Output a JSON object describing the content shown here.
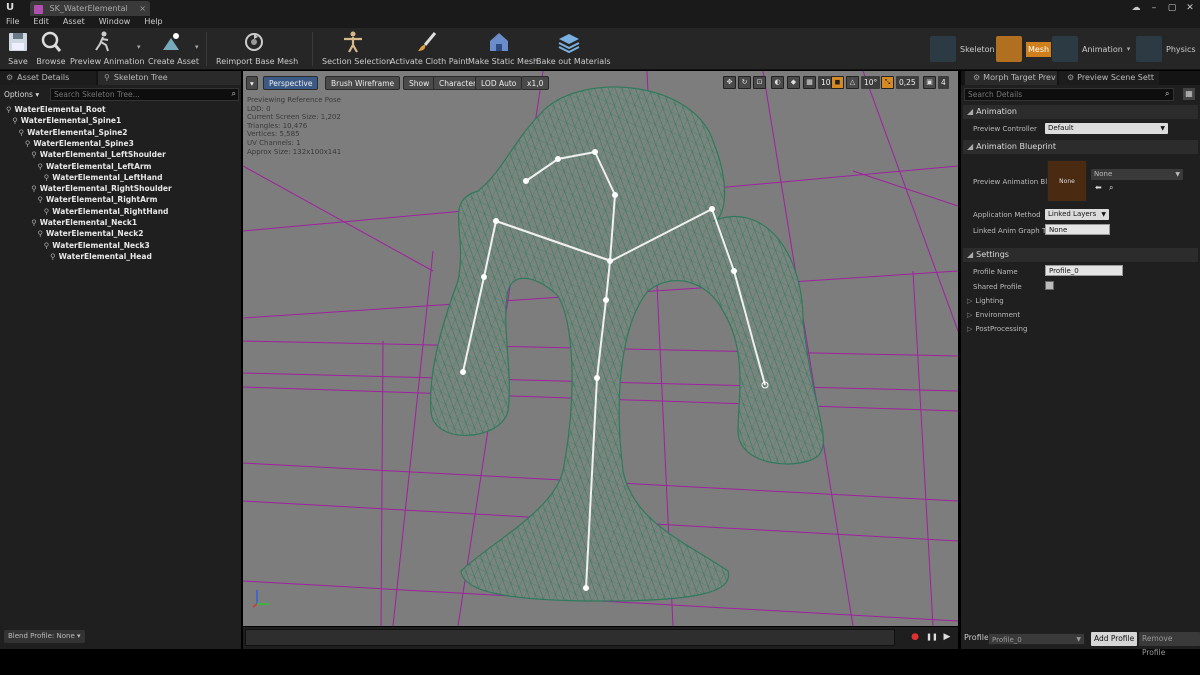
{
  "window": {
    "app_logo": "U",
    "tab_title": "SK_WaterElemental",
    "tab_close": "×",
    "controls": [
      "☁",
      "–",
      "▢",
      "✕"
    ]
  },
  "menu": [
    "File",
    "Edit",
    "Asset",
    "Window",
    "Help"
  ],
  "toolbar": {
    "save": "Save",
    "browse": "Browse",
    "preview_animation": "Preview Animation",
    "create_asset": "Create Asset",
    "reimport_base_mesh": "Reimport Base Mesh",
    "section_selection": "Section Selection",
    "activate_cloth_paint": "Activate Cloth Paint",
    "make_static_mesh": "Make Static Mesh",
    "bake_out_materials": "Bake out Materials",
    "modes": [
      "Skeleton",
      "Mesh",
      "Animation",
      "Physics"
    ],
    "active_mode": "Mesh",
    "accent_color": "#d07f1f"
  },
  "left_panel": {
    "tabs": [
      "Asset Details",
      "Skeleton Tree"
    ],
    "options_label": "Options ▾",
    "search_placeholder": "Search Skeleton Tree...",
    "bones": [
      {
        "name": "WaterElemental_Root",
        "depth": 0
      },
      {
        "name": "WaterElemental_Spine1",
        "depth": 1
      },
      {
        "name": "WaterElemental_Spine2",
        "depth": 2
      },
      {
        "name": "WaterElemental_Spine3",
        "depth": 3
      },
      {
        "name": "WaterElemental_LeftShoulder",
        "depth": 4
      },
      {
        "name": "WaterElemental_LeftArm",
        "depth": 5
      },
      {
        "name": "WaterElemental_LeftHand",
        "depth": 6
      },
      {
        "name": "WaterElemental_RightShoulder",
        "depth": 4
      },
      {
        "name": "WaterElemental_RightArm",
        "depth": 5
      },
      {
        "name": "WaterElemental_RightHand",
        "depth": 6
      },
      {
        "name": "WaterElemental_Neck1",
        "depth": 4
      },
      {
        "name": "WaterElemental_Neck2",
        "depth": 5
      },
      {
        "name": "WaterElemental_Neck3",
        "depth": 6
      },
      {
        "name": "WaterElemental_Head",
        "depth": 7
      }
    ],
    "blend_profile": "Blend Profile: None ▾"
  },
  "viewport": {
    "perspective": "Perspective",
    "brush_wireframe": "Brush Wireframe",
    "show": "Show",
    "character": "Character",
    "lod": "LOD Auto",
    "playback_speed": "x1,0",
    "grid_snap": "10",
    "rotation_snap": "10°",
    "scale_snap": "0,25",
    "camera_speed": "4",
    "stats": [
      "Previewing Reference Pose",
      "LOD: 0",
      "Current Screen Size: 1,202",
      "Triangles: 10,476",
      "Vertices: 5,585",
      "UV Channels: 1",
      "Approx Size: 132x100x141"
    ],
    "wire_color": "#2f7a5c",
    "grid_color": "#a020a0"
  },
  "timeline": {
    "record": "●",
    "pause": "❚❚",
    "forward": "▶"
  },
  "right_panel": {
    "tabs": [
      "Morph Target Prev",
      "Preview Scene Sett"
    ],
    "search_placeholder": "Search Details",
    "sections": {
      "animation": "Animation",
      "animation_blueprint": "Animation Blueprint",
      "settings": "Settings"
    },
    "props": {
      "preview_controller_label": "Preview Controller",
      "preview_controller_value": "Default",
      "preview_anim_bp_label": "Preview Animation Bl",
      "preview_anim_bp_value": "None",
      "thumb_label": "None",
      "application_method_label": "Application Method",
      "application_method_value": "Linked Layers",
      "linked_anim_graph_label": "Linked Anim Graph Ta",
      "linked_anim_graph_value": "None",
      "profile_name_label": "Profile Name",
      "profile_name_value": "Profile_0",
      "shared_profile_label": "Shared Profile",
      "lighting": "Lighting",
      "environment": "Environment",
      "postprocessing": "PostProcessing"
    },
    "footer": {
      "profile_label": "Profile",
      "profile_value": "Profile_0",
      "add_profile": "Add Profile",
      "remove_profile": "Remove Profile"
    }
  }
}
